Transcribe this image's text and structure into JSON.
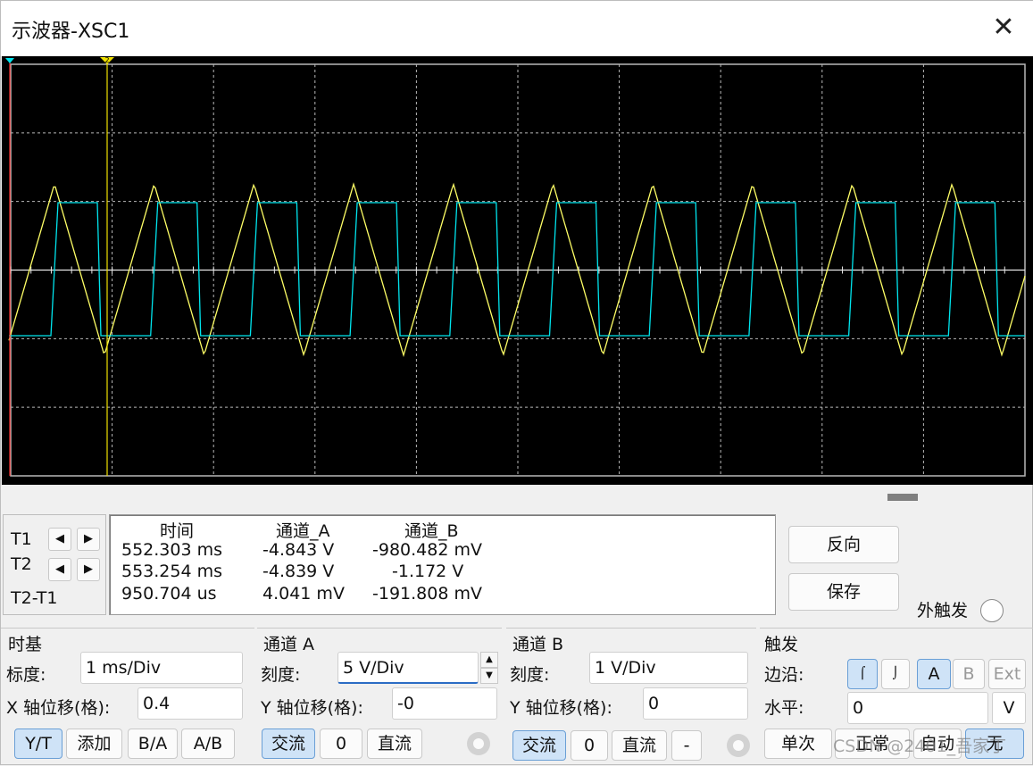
{
  "window": {
    "title": "示波器-XSC1",
    "close_icon": "close-icon"
  },
  "colors": {
    "channel_a": "#ffff66",
    "channel_b": "#00e5ee",
    "grid": "#b8b8b8",
    "screen_bg": "#000000",
    "cursor_t1": "#ff3030",
    "cursor_t2": "#f0e000"
  },
  "cursors": {
    "t1_label": "T1",
    "t2_label": "T2",
    "diff_label": "T2-T1",
    "left_arrow": "◀",
    "right_arrow": "▶",
    "t2_marker": "2"
  },
  "readout": {
    "headers": [
      "时间",
      "通道_A",
      "通道_B"
    ],
    "rows": [
      [
        "552.303 ms",
        "-4.843 V",
        "-980.482 mV"
      ],
      [
        "553.254 ms",
        "-4.839 V",
        "-1.172 V"
      ],
      [
        "950.704 us",
        "4.041 mV",
        "-191.808 mV"
      ]
    ]
  },
  "side": {
    "reverse": "反向",
    "save": "保存",
    "ext_trigger": "外触发"
  },
  "timebase": {
    "title": "时基",
    "scale_label": "标度:",
    "scale_value": "1 ms/Div",
    "xpos_label": "X 轴位移(格):",
    "xpos_value": "0.4",
    "modes": [
      "Y/T",
      "添加",
      "B/A",
      "A/B"
    ]
  },
  "channel_a": {
    "title": "通道 A",
    "scale_label": "刻度:",
    "scale_value": "5  V/Div",
    "ypos_label": "Y 轴位移(格):",
    "ypos_value": "-0",
    "coupling": [
      "交流",
      "0",
      "直流"
    ]
  },
  "channel_b": {
    "title": "通道 B",
    "scale_label": "刻度:",
    "scale_value": "1  V/Div",
    "ypos_label": "Y 轴位移(格):",
    "ypos_value": "0",
    "coupling": [
      "交流",
      "0",
      "直流",
      "-"
    ]
  },
  "trigger": {
    "title": "触发",
    "edge_label": "边沿:",
    "level_label": "水平:",
    "level_value": "0",
    "level_unit": "V",
    "sources": [
      "A",
      "B",
      "Ext"
    ],
    "modes": [
      "单次",
      "正常",
      "自动",
      "无"
    ]
  },
  "watermark": "CSDN @2401_吾家丁"
}
